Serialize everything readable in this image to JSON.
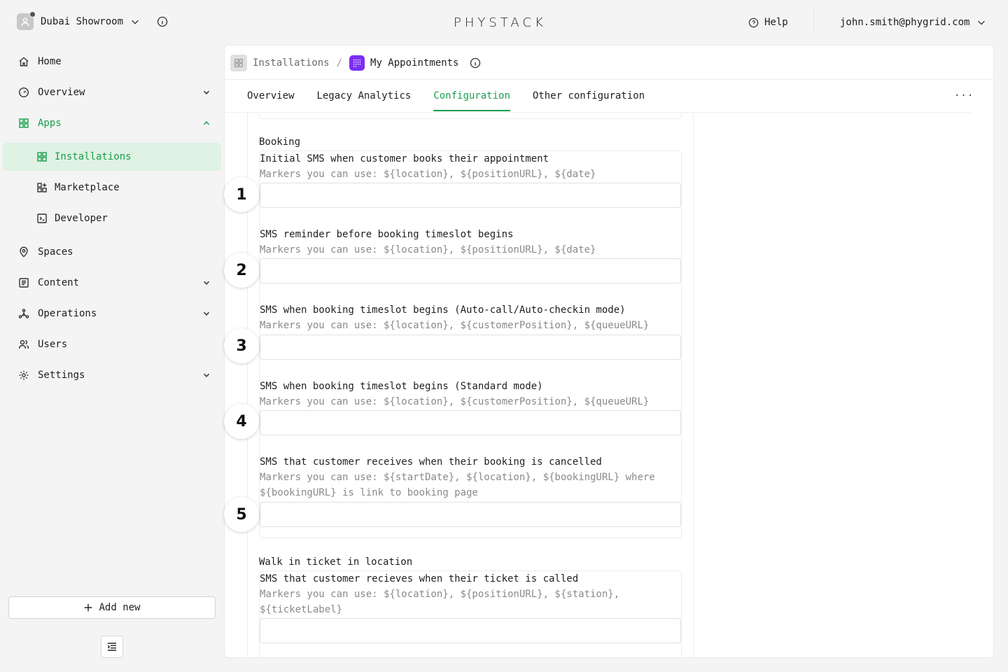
{
  "header": {
    "org_name": "Dubai Showroom",
    "logo_text": "PHYSTACK",
    "help_label": "Help",
    "user_email": "john.smith@phygrid.com"
  },
  "sidebar": {
    "items": [
      {
        "label": "Home"
      },
      {
        "label": "Overview"
      },
      {
        "label": "Apps"
      },
      {
        "label": "Installations"
      },
      {
        "label": "Marketplace"
      },
      {
        "label": "Developer"
      },
      {
        "label": "Spaces"
      },
      {
        "label": "Content"
      },
      {
        "label": "Operations"
      },
      {
        "label": "Users"
      },
      {
        "label": "Settings"
      }
    ],
    "add_new_label": "Add new"
  },
  "breadcrumb": {
    "parent": "Installations",
    "separator": "/",
    "current": "My Appointments"
  },
  "tabs": [
    {
      "label": "Overview"
    },
    {
      "label": "Legacy Analytics"
    },
    {
      "label": "Configuration"
    },
    {
      "label": "Other configuration"
    }
  ],
  "active_tab": "Configuration",
  "more_label": "...",
  "form": {
    "booking_title": "Booking",
    "booking_fields": [
      {
        "label": "Initial SMS when customer books their appointment",
        "hint": "Markers you can use: ${location}, ${positionURL}, ${date}",
        "value": ""
      },
      {
        "label": "SMS reminder before booking timeslot begins",
        "hint": "Markers you can use: ${location}, ${positionURL}, ${date}",
        "value": ""
      },
      {
        "label": "SMS when booking timeslot begins (Auto-call/Auto-checkin mode)",
        "hint": "Markers you can use: ${location}, ${customerPosition}, ${queueURL}",
        "value": ""
      },
      {
        "label": "SMS when booking timeslot begins (Standard mode)",
        "hint": "Markers you can use: ${location}, ${customerPosition}, ${queueURL}",
        "value": ""
      },
      {
        "label": "SMS that customer receives when their booking is cancelled",
        "hint": "Markers you can use: ${startDate}, ${location}, ${bookingURL} where ${bookingURL} is link to booking page",
        "value": ""
      }
    ],
    "walkin_title": "Walk in ticket in location",
    "walkin_fields": [
      {
        "label": "SMS that customer recieves when their ticket is called",
        "hint": "Markers you can use: ${location}, ${positionURL}, ${station}, ${ticketLabel}",
        "value": ""
      }
    ]
  },
  "annotations": [
    "1",
    "2",
    "3",
    "4",
    "5"
  ],
  "colors": {
    "accent": "#1a9e4c",
    "active_bg": "#dff2e4",
    "app_icon": "#7b2ff2"
  }
}
